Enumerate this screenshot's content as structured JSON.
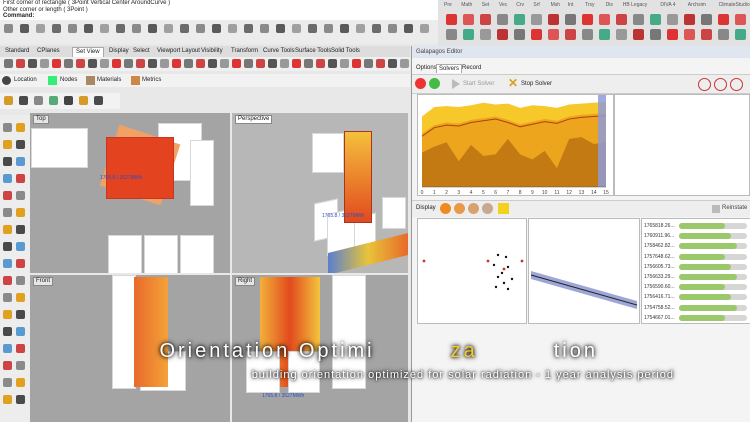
{
  "command": {
    "line1": "First corner of rectangle ( 3Point  Vertical  Center  AroundCurve )",
    "line2": "Other corner or length ( 3Point )",
    "prompt": "Command:"
  },
  "toolbar_tabs": [
    "Standard",
    "CPlanes",
    "Set View",
    "Display",
    "Select",
    "Viewport Layout",
    "Visibility",
    "Transform",
    "Curve Tools",
    "Surface Tools",
    "Solid Tools"
  ],
  "panel_tabs": [
    "Location",
    "Nodes",
    "Materials",
    "Metrics"
  ],
  "viewports": {
    "top": {
      "label": "Top",
      "annotation": "1765.8 / 3527MWh"
    },
    "perspective": {
      "label": "Perspective",
      "annotation": "1765.8 / 3527MWh"
    },
    "front": {
      "label": "Front"
    },
    "right": {
      "label": "Right",
      "annotation": "1765.8 / 3527MWh"
    }
  },
  "gh_menu": [
    "Pre",
    "Math",
    "Set",
    "Vec",
    "Crv",
    "Srf",
    "Msh",
    "Int",
    "Trsy",
    "Dis",
    "HB Legacy",
    "DIVA 4",
    "Archsim",
    "ClimateStudio"
  ],
  "galapagos": {
    "title": "Galapagos Editor",
    "tabs": [
      "Options",
      "Solvers",
      "Record"
    ],
    "start_label": "Start Solver",
    "stop_label": "Stop Solver",
    "display_label": "Display",
    "reinstate_label": "Reinstate",
    "axis_labels": [
      "0",
      "1",
      "2",
      "3",
      "4",
      "5",
      "6",
      "7",
      "8",
      "9",
      "10",
      "11",
      "12",
      "13",
      "14",
      "15"
    ],
    "fitness_values": [
      "1765818.26...",
      "1760911.96...",
      "1758462.82...",
      "1757648.62...",
      "1756605.73...",
      "1756633.29...",
      "1756590.60...",
      "1756416.71...",
      "1754758.52...",
      "1754667.01..."
    ]
  },
  "chart_data": {
    "type": "area",
    "x": [
      0,
      1,
      2,
      3,
      4,
      5,
      6,
      7,
      8,
      9,
      10,
      11,
      12,
      13,
      14,
      15
    ],
    "series": [
      {
        "values": [
          0.82,
          0.93,
          0.94,
          0.93,
          0.95,
          0.98,
          0.96,
          0.97,
          0.92,
          0.95,
          0.94,
          0.92,
          0.96,
          0.97,
          0.98,
          0.99
        ]
      },
      {
        "values": [
          0.62,
          0.72,
          0.75,
          0.74,
          0.78,
          0.8,
          0.82,
          0.78,
          0.73,
          0.76,
          0.79,
          0.77,
          0.82,
          0.84,
          0.85,
          0.86
        ]
      },
      {
        "values": [
          0.4,
          0.47,
          0.52,
          0.3,
          0.49,
          0.36,
          0.38,
          0.56,
          0.38,
          0.32,
          0.42,
          0.22,
          0.56,
          0.58,
          0.5,
          0.52
        ]
      }
    ],
    "colors": [
      "#f6c829",
      "#eca51c",
      "#c47a12"
    ],
    "xlim": [
      0,
      15
    ],
    "ylim": [
      0,
      1
    ]
  },
  "overlay": {
    "title_a": "Orientation Optimi",
    "title_b": "za",
    "title_c": "tion",
    "subtitle": "building orientation optimized for solar radiation - 1 year analysis period"
  }
}
